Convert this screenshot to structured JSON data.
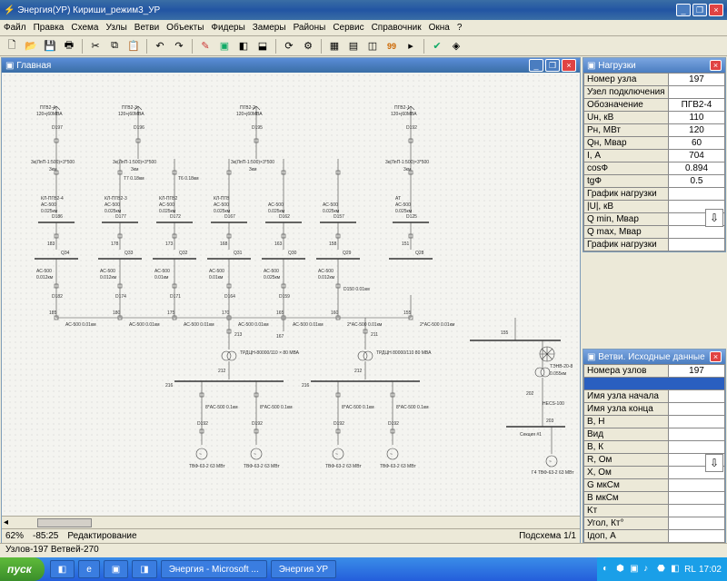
{
  "window": {
    "title": "Энергия(УР) Кириши_режим3_УР"
  },
  "menubar": [
    "Файл",
    "Правка",
    "Схема",
    "Узлы",
    "Ветви",
    "Объекты",
    "Фидеры",
    "Замеры",
    "Районы",
    "Сервис",
    "Справочник",
    "Окна",
    "?"
  ],
  "main": {
    "title": "Главная"
  },
  "status": {
    "zoom": "62%",
    "coords": "-85:25",
    "mode": "Редактирование",
    "page": "Подсхема 1/1"
  },
  "bottom_status": "Узлов-197 Ветвей-270",
  "panel_nagruzki": {
    "title": "Нагрузки",
    "rows": [
      {
        "lab": "Номер узла",
        "val": "197"
      },
      {
        "lab": "Узел подключения",
        "val": ""
      },
      {
        "lab": "Обозначение",
        "val": "ПГВ2-4"
      },
      {
        "lab": "Uн, кВ",
        "val": "110"
      },
      {
        "lab": "Pн, МВт",
        "val": "120"
      },
      {
        "lab": "Qн, Мвар",
        "val": "60"
      },
      {
        "lab": "I, А",
        "val": "704"
      },
      {
        "lab": "cosФ",
        "val": "0.894"
      },
      {
        "lab": "tgФ",
        "val": "0.5"
      },
      {
        "lab": "График нагрузки",
        "val": ""
      },
      {
        "lab": "|U|, кВ",
        "val": ""
      },
      {
        "lab": "Q min, Мвар",
        "val": ""
      },
      {
        "lab": "Q max, Мвар",
        "val": ""
      },
      {
        "lab": "График нагрузки",
        "val": ""
      }
    ]
  },
  "panel_vetvi": {
    "title": "Ветви. Исходные данные",
    "rows": [
      {
        "lab": "Номера узлов",
        "val": "197"
      },
      {
        "lab": "",
        "val": "",
        "blue": true
      },
      {
        "lab": "Имя узла начала",
        "val": ""
      },
      {
        "lab": "Имя узла конца",
        "val": ""
      },
      {
        "lab": "B, Н",
        "val": ""
      },
      {
        "lab": "Вид",
        "val": ""
      },
      {
        "lab": "B, К",
        "val": ""
      },
      {
        "lab": "R, Ом",
        "val": ""
      },
      {
        "lab": "X, Ом",
        "val": ""
      },
      {
        "lab": "G мкСм",
        "val": ""
      },
      {
        "lab": "B мкСм",
        "val": ""
      },
      {
        "lab": "Kт",
        "val": ""
      },
      {
        "lab": "Угол, Кт°",
        "val": ""
      },
      {
        "lab": "Iдоп, А",
        "val": ""
      }
    ]
  },
  "schematic": {
    "top_loads": [
      {
        "name": "ПГВ2-4",
        "rating": "120+j60МВА",
        "node": "D197"
      },
      {
        "name": "ПГВ2-3",
        "rating": "120+j60МВА",
        "node": "D196"
      },
      {
        "name": "ПГВ2-2",
        "rating": "120+j60МВА",
        "node": "D195"
      },
      {
        "name": "ПГВ2-1",
        "rating": "120+j60МВА",
        "node": "D192"
      }
    ],
    "lines_top": "3к(ЛпП-1:500)×3*500",
    "branches": [
      {
        "node": "D186",
        "label": "КЛ-ПГВ2-4",
        "cond": "АС-500",
        "len": "0.025км"
      },
      {
        "node": "D177",
        "label": "КЛ-ПГВ2-3",
        "cond": "АС-500",
        "len": "0.025км",
        "t": "T7 0.18км"
      },
      {
        "node": "D172",
        "label": "КЛ-ПГВ2",
        "cond": "АС-500",
        "len": "0.025км",
        "t": "T6 0.18км"
      },
      {
        "node": "D167",
        "label": "КЛ-ПГВ",
        "cond": "АС-500",
        "len": "0.025км"
      },
      {
        "node": "D162",
        "cond": "АС-500",
        "len": "0.025км"
      },
      {
        "node": "D157",
        "cond": "АС-500",
        "len": "0.025км"
      },
      {
        "node": "D125",
        "label": "АТ",
        "cond": "АС-500",
        "len": "0.025км"
      }
    ],
    "qbuses": [
      {
        "n": "183",
        "q": "Q34"
      },
      {
        "n": "178",
        "q": "Q33"
      },
      {
        "n": "173",
        "q": "Q32"
      },
      {
        "n": "168",
        "q": "Q31"
      },
      {
        "n": "163",
        "q": "Q30"
      },
      {
        "n": "158",
        "q": "Q29"
      },
      {
        "n": "151",
        "q": "Q28"
      }
    ],
    "mid_nodes": [
      {
        "cond": "АС-500",
        "len": "0.012км",
        "node": "D182"
      },
      {
        "cond": "АС-500",
        "len": "0.012км",
        "node": "D174"
      },
      {
        "cond": "АС-500",
        "len": "0.01км",
        "node": "D171"
      },
      {
        "cond": "АС-500",
        "len": "0.01км",
        "node": "D164"
      },
      {
        "cond": "АС-500",
        "len": "0.025км",
        "node": "D159"
      },
      {
        "cond": "АС-500",
        "len": "0.012км",
        "extra": "D150 0.01км"
      }
    ],
    "h_links": [
      "185",
      "180",
      "175",
      "170",
      "165",
      "160",
      "155"
    ],
    "h_cond": "АС-500 0.01км",
    "h_cond2": "2*АС-500 0.01км",
    "transformers": [
      {
        "label": "ТРДЦН-80000/110 × 80 МВА",
        "n1": "213",
        "n2": "212"
      },
      {
        "label": "ТРДЦН 80000/110 80 МВА",
        "n1": "211",
        "n2": "212"
      }
    ],
    "gens": [
      {
        "bus": "216",
        "line": "8*АС-500 0.1км",
        "node": "D192",
        "gen": "ТВФ-63-2 63 МВт"
      },
      {
        "bus": "216",
        "line": "8*АС-500 0.1км",
        "node": "D192",
        "gen": "ТВФ-63-2 63 МВт"
      }
    ],
    "right_side": {
      "tene": "ТЭНВ-20-8",
      "len": "0.055км",
      "n": "202",
      "necs": "НЕCS-100",
      "n2": "203",
      "sect": "Секция #1",
      "gen": "Г4 ТВФ-63-2 63 МВт"
    },
    "node155": "155"
  },
  "taskbar": {
    "start": "пуск",
    "tasks": [
      "Энергия - Microsoft ...",
      "Энергия УР"
    ],
    "lang": "RL",
    "time": "17:02"
  }
}
